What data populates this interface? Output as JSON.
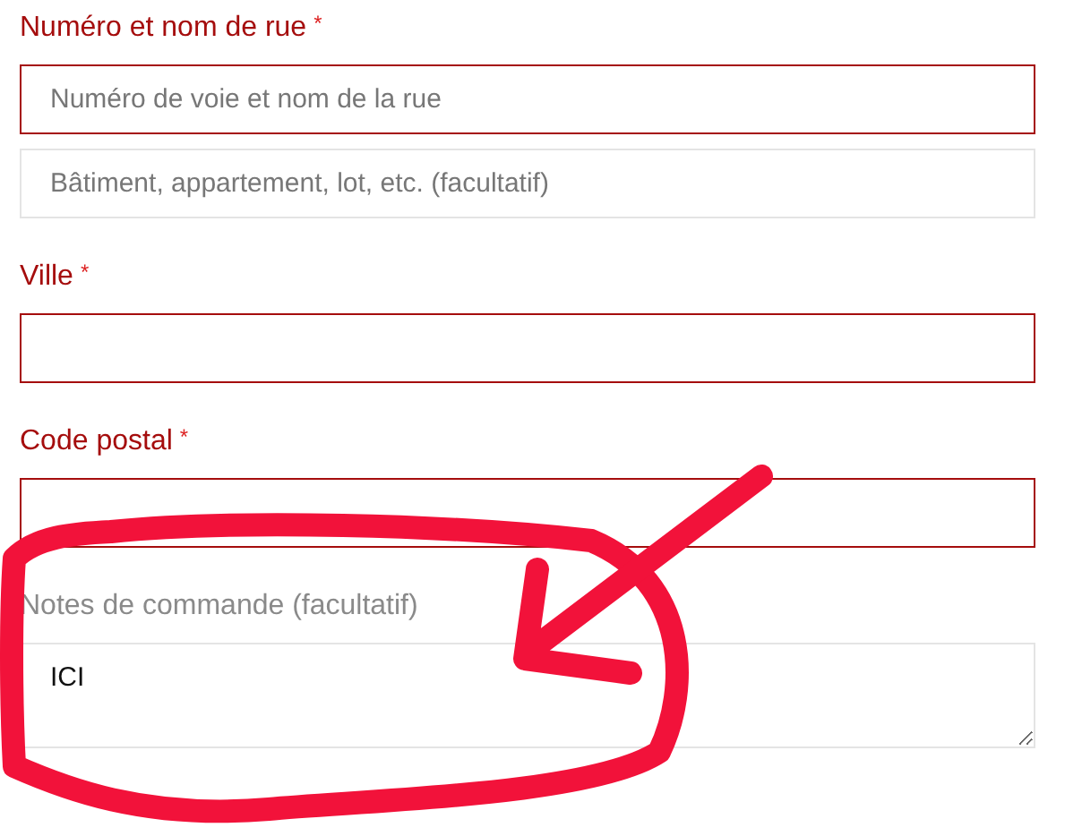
{
  "fields": [
    {
      "label": "Numéro et nom de rue",
      "required_mark": "*",
      "inputs": [
        {
          "kind": "input",
          "placeholder": "Numéro de voie et nom de la rue",
          "invalid": true
        },
        {
          "kind": "input",
          "placeholder": "Bâtiment, appartement, lot, etc. (facultatif)",
          "invalid": false
        }
      ]
    },
    {
      "label": "Ville",
      "required_mark": "*",
      "inputs": [
        {
          "kind": "input",
          "invalid": true
        }
      ]
    },
    {
      "label": "Code postal",
      "required_mark": "*",
      "inputs": [
        {
          "kind": "input",
          "invalid": true
        }
      ]
    },
    {
      "label": "Notes de commande (facultatif)",
      "inputs": [
        {
          "kind": "textarea",
          "value": "ICI",
          "invalid": false
        }
      ]
    }
  ]
}
